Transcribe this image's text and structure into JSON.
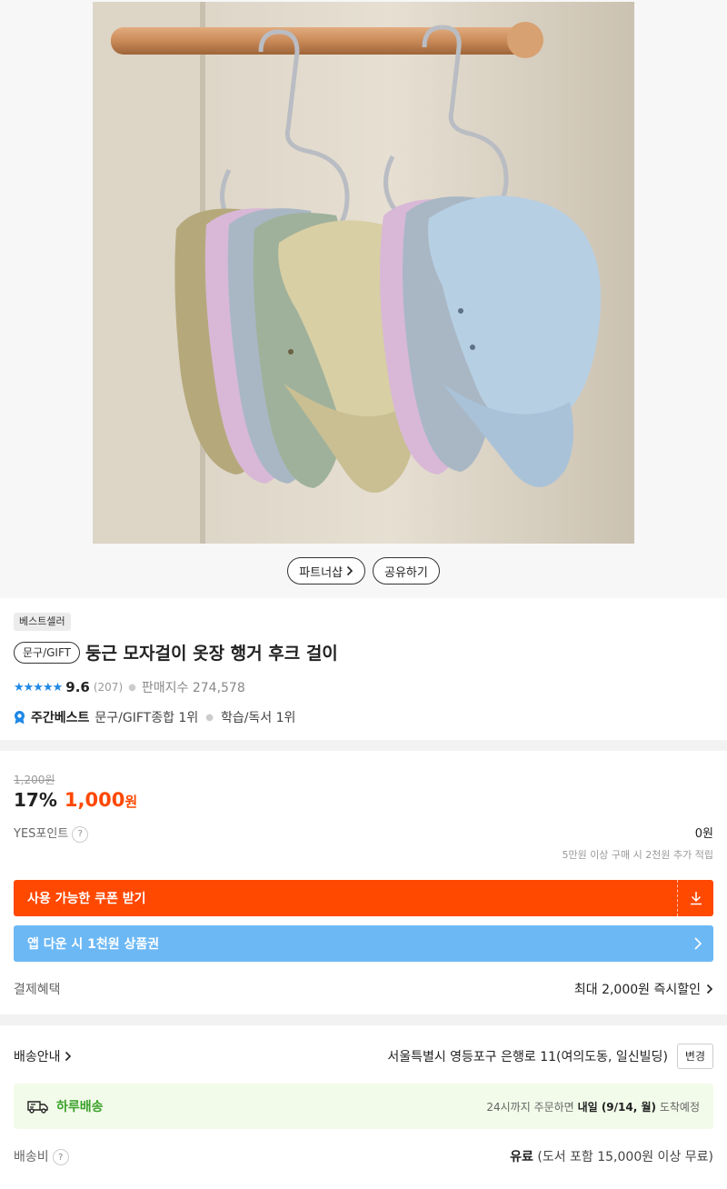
{
  "hero": {
    "partner_label": "파트너샵",
    "share_label": "공유하기"
  },
  "product": {
    "badge": "베스트셀러",
    "category": "문구/GIFT",
    "title": "둥근 모자걸이 옷장 행거 후크 걸이",
    "rating": "9.6",
    "review_count": "(207)",
    "sales_index": "판매지수 274,578",
    "rank_title": "주간베스트",
    "rank_1": "문구/GIFT종합 1위",
    "rank_2": "학습/독서 1위"
  },
  "price": {
    "original": "1,200원",
    "discount": "17%",
    "amount": "1,000",
    "unit": "원",
    "points_label": "YES포인트",
    "points_value": "0원",
    "points_note": "5만원 이상 구매 시 2천원 추가 적립",
    "coupon_label": "사용 가능한 쿠폰 받기",
    "app_label": "앱 다운 시 1천원 상품권",
    "pay_label": "결제혜택",
    "pay_value": "최대 2,000원 즉시할인"
  },
  "shipping": {
    "label": "배송안내",
    "address": "서울특별시 영등포구 은행로 11(여의도동, 일신빌딩)",
    "change_label": "변경",
    "day_label": "하루배송",
    "day_prefix": "24시까지 주문하면",
    "day_date": "내일 (9/14, 월)",
    "day_suffix": "도착예정",
    "fee_label": "배송비",
    "fee_bold": "유료",
    "fee_note": "(도서 포함 15,000원 이상 무료)"
  },
  "colors": {
    "accent_orange": "#ff4800",
    "app_blue": "#6cb8f5",
    "rating_blue": "#1e88e5",
    "delivery_green": "#3aa12a"
  }
}
